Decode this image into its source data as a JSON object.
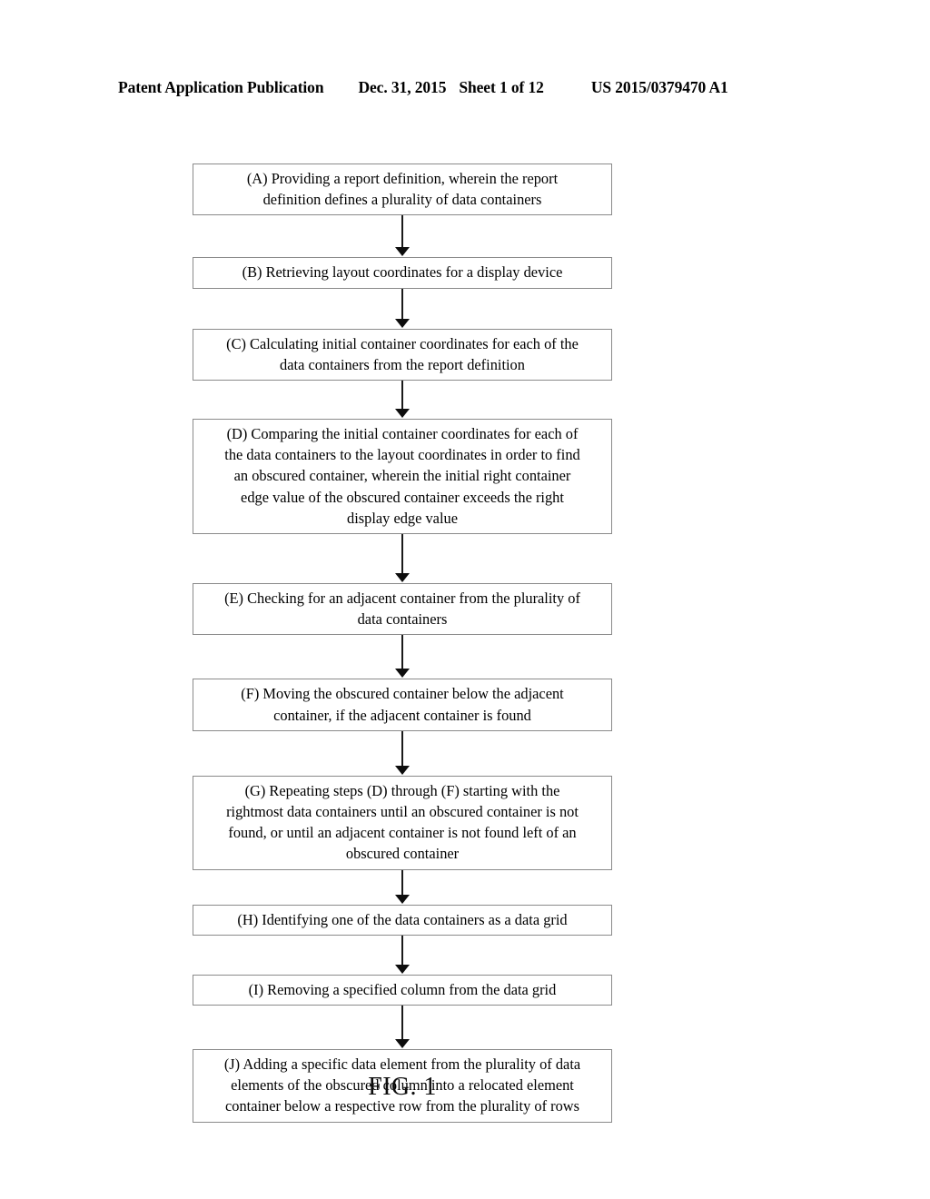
{
  "header": {
    "publication": "Patent Application Publication",
    "date": "Dec. 31, 2015",
    "sheet": "Sheet 1 of 12",
    "publication_number": "US 2015/0379470 A1"
  },
  "figure": {
    "caption": "FIG. 1",
    "type": "flowchart",
    "orientation": "vertical",
    "node_count": 10,
    "connector_count": 9
  },
  "flowchart": {
    "nodes": [
      {
        "id": "A",
        "text": "(A) Providing a report definition, wherein the report definition defines a plurality of data containers",
        "lines": [
          "(A) Providing a report definition, wherein the report",
          "definition defines a plurality of data containers"
        ]
      },
      {
        "id": "B",
        "text": "(B) Retrieving layout coordinates for a display device",
        "lines": [
          "(B) Retrieving layout coordinates for a display device"
        ]
      },
      {
        "id": "C",
        "text": "(C) Calculating initial container coordinates for each of the data containers from the report definition",
        "lines": [
          "(C) Calculating initial container coordinates for each of the",
          "data containers from the report definition"
        ]
      },
      {
        "id": "D",
        "text": "(D) Comparing the initial container coordinates for each of the data containers to the layout coordinates in order to find an obscured container, wherein the initial right container edge value of the obscured container exceeds the right display edge value",
        "lines": [
          "(D) Comparing the initial container coordinates for each of",
          "the data containers to the layout coordinates in order to find",
          "an obscured container, wherein the initial right container",
          "edge value of the obscured container exceeds the right",
          "display edge value"
        ]
      },
      {
        "id": "E",
        "text": "(E) Checking for an adjacent container from the plurality of data containers",
        "lines": [
          "(E) Checking for an adjacent container from the plurality of",
          "data containers"
        ]
      },
      {
        "id": "F",
        "text": "(F) Moving the obscured container below the adjacent container, if the adjacent container is found",
        "lines": [
          "(F) Moving the obscured container below the adjacent",
          "container, if the adjacent container is found"
        ]
      },
      {
        "id": "G",
        "text": "(G) Repeating steps (D) through (F) starting with the rightmost data containers until an obscured container is not found, or until an adjacent container is not found left of an obscured container",
        "lines": [
          "(G) Repeating steps (D) through (F) starting with the",
          "rightmost data containers until an obscured container is not",
          "found, or until an adjacent container is not found left of an",
          "obscured container"
        ]
      },
      {
        "id": "H",
        "text": "(H) Identifying one of the data containers as a data grid",
        "lines": [
          "(H) Identifying one of the data containers as a data grid"
        ]
      },
      {
        "id": "I",
        "text": "(I) Removing a specified column from the data grid",
        "lines": [
          "(I) Removing a specified column from the data grid"
        ]
      },
      {
        "id": "J",
        "text": "(J) Adding a specific data element from the plurality of data elements of the obscured column into a relocated element container below a respective row from the plurality of rows",
        "lines": [
          "(J) Adding a specific data element from the plurality of data",
          "elements of the obscured column into a relocated element",
          "container below a respective row from the plurality of rows"
        ]
      }
    ]
  },
  "colors": {
    "page_background": "#ffffff",
    "text": "#000000",
    "node_border": "#8a8a8a",
    "connector": "#0d0d0d"
  }
}
